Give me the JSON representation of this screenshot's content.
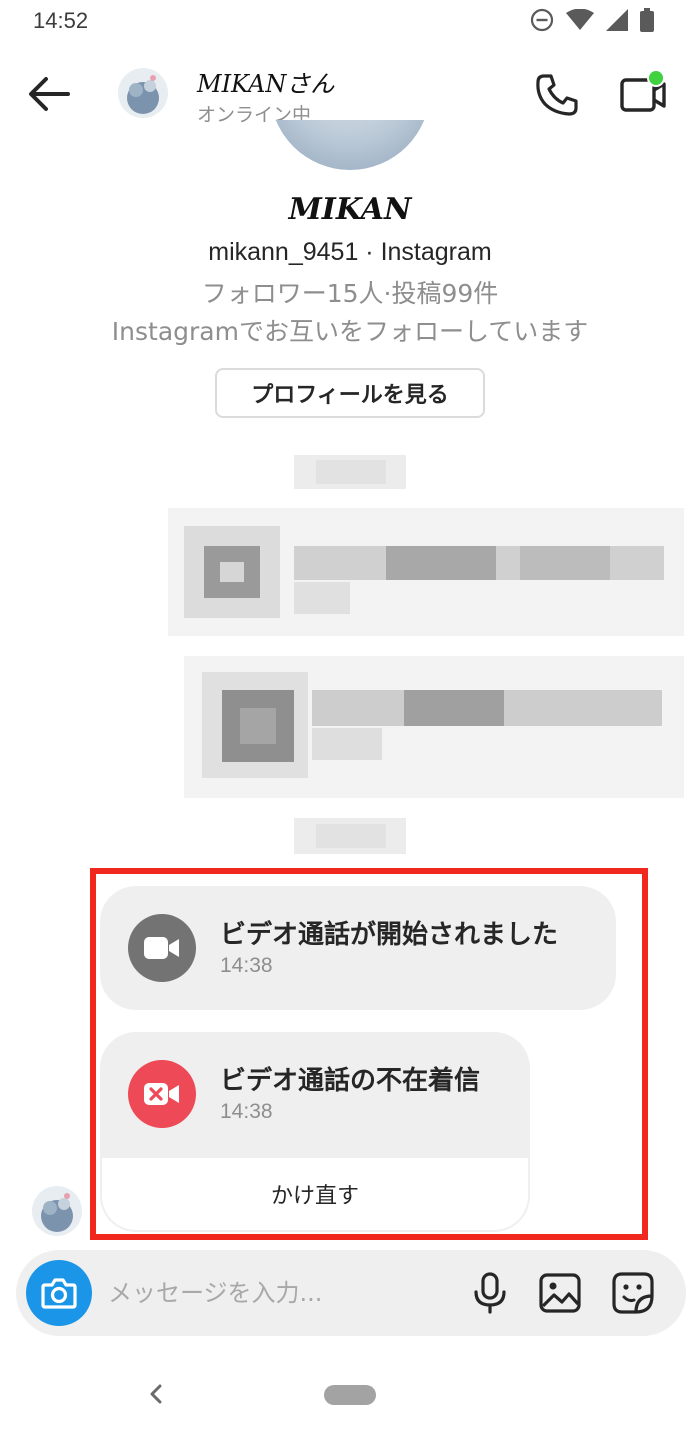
{
  "status_bar": {
    "time": "14:52",
    "icons": [
      "do-not-disturb-icon",
      "wifi-icon",
      "signal-icon",
      "battery-icon"
    ]
  },
  "header": {
    "name": "MIKANさん",
    "status": "オンライン中",
    "icons": [
      "back-arrow-icon",
      "phone-icon",
      "video-camera-icon"
    ],
    "online_dot_color": "#3fd13f"
  },
  "profile": {
    "name": "MIKAN",
    "handle_line": "mikann_9451 · Instagram",
    "stats": "フォロワー15人·投稿99件",
    "mutual": "Instagramでお互いをフォローしています",
    "view_profile_button": "プロフィールを見る"
  },
  "calls": {
    "started": {
      "title": "ビデオ通話が開始されました",
      "time": "14:38",
      "icon": "video-camera-icon",
      "icon_color": "#737373"
    },
    "missed": {
      "title": "ビデオ通話の不在着信",
      "time": "14:38",
      "icon": "missed-video-icon",
      "icon_color": "#ed4956",
      "redial_label": "かけ直す"
    },
    "highlight_color": "#f0281e"
  },
  "composer": {
    "placeholder": "メッセージを入力...",
    "camera_color": "#1b95e8",
    "icons": [
      "camera-icon",
      "microphone-icon",
      "gallery-icon",
      "sticker-icon"
    ]
  },
  "nav": {
    "icons": [
      "nav-back-icon",
      "home-pill-icon"
    ]
  }
}
